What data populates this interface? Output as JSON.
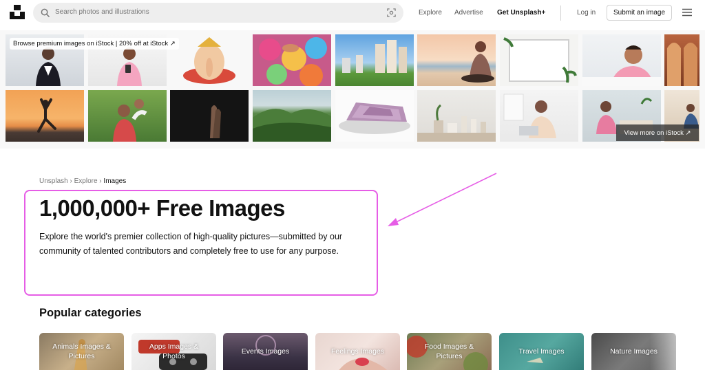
{
  "header": {
    "search_placeholder": "Search photos and illustrations",
    "nav": {
      "explore": "Explore",
      "advertise": "Advertise",
      "get_plus": "Get Unsplash+",
      "login": "Log in",
      "submit": "Submit an image"
    }
  },
  "banner": {
    "promo": "Browse premium images on iStock | 20% off at iStock ↗",
    "view_more": "View more on iStock ↗"
  },
  "breadcrumb": {
    "items": [
      "Unsplash",
      "Explore",
      "Images"
    ],
    "separator": "›"
  },
  "hero": {
    "title": "1,000,000+ Free Images",
    "description": "Explore the world's premier collection of high-quality pictures—submitted by our community of talented contributors and completely free to use for any purpose."
  },
  "popular": {
    "title": "Popular categories",
    "categories": [
      {
        "label": "Animals Images & Pictures"
      },
      {
        "label": "Apps Images & Photos"
      },
      {
        "label": "Events Images"
      },
      {
        "label": "Feelings Images"
      },
      {
        "label": "Food Images & Pictures"
      },
      {
        "label": "Travel Images"
      },
      {
        "label": "Nature Images"
      }
    ]
  },
  "colors": {
    "highlight": "#e65de6",
    "text_primary": "#111111",
    "text_secondary": "#767676"
  }
}
